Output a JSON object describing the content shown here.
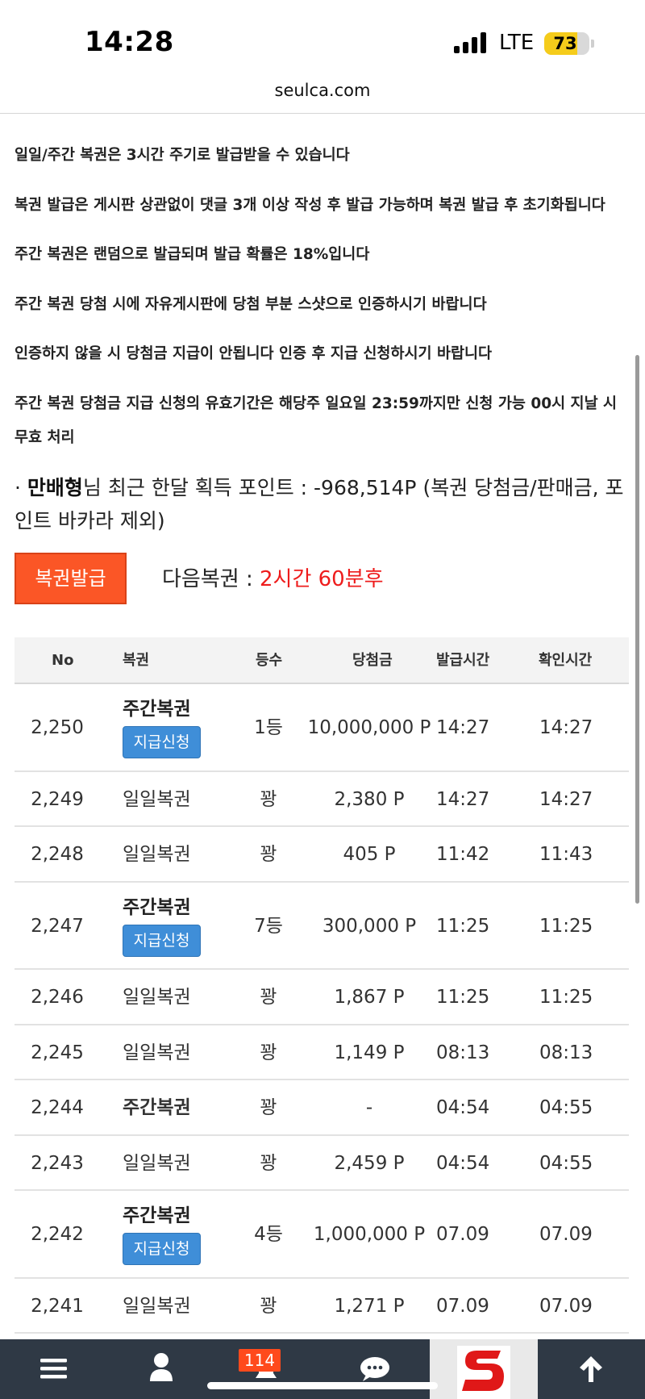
{
  "status_bar": {
    "time": "14:28",
    "network": "LTE",
    "battery": "73"
  },
  "browser": {
    "url": "seulca.com"
  },
  "notices": [
    "일일/주간 복권은 3시간 주기로 발급받을 수 있습니다",
    "복권 발급은 게시판 상관없이 댓글 3개 이상 작성 후 발급 가능하며 복권 발급 후 초기화됩니다",
    "주간 복권은 랜덤으로 발급되며 발급 확률은 18%입니다",
    "주간 복권 당첨 시에 자유게시판에 당첨 부분 스샷으로 인증하시기 바랍니다",
    "인증하지 않을 시 당첨금 지급이 안됩니다 인증 후 지급 신청하시기 바랍니다",
    "주간 복권 당첨금 지급 신청의 유효기간은 해당주 일요일 23:59까지만 신청 가능 00시 지날 시 무효 처리"
  ],
  "points": {
    "bullet": "·",
    "username": "만배형",
    "text": "님 최근 한달 획득 포인트 : -968,514P (복권 당첨금/판매금, 포인트 바카라 제외)"
  },
  "issue": {
    "button_label": "복권발급",
    "next_label": "다음복권 : ",
    "next_value": "2시간 60분후"
  },
  "table": {
    "headers": {
      "no": "No",
      "lottery": "복권",
      "rank": "등수",
      "prize": "당첨금",
      "issued": "발급시간",
      "checked": "확인시간"
    },
    "rows": [
      {
        "no": "2,250",
        "lottery": "주간복권",
        "claim": "지급신청",
        "rank": "1등",
        "prize": "10,000,000 P",
        "issued": "14:27",
        "checked": "14:27"
      },
      {
        "no": "2,249",
        "lottery": "일일복권",
        "rank": "꽝",
        "prize": "2,380 P",
        "issued": "14:27",
        "checked": "14:27"
      },
      {
        "no": "2,248",
        "lottery": "일일복권",
        "rank": "꽝",
        "prize": "405 P",
        "issued": "11:42",
        "checked": "11:43"
      },
      {
        "no": "2,247",
        "lottery": "주간복권",
        "claim": "지급신청",
        "rank": "7등",
        "prize": "300,000 P",
        "issued": "11:25",
        "checked": "11:25"
      },
      {
        "no": "2,246",
        "lottery": "일일복권",
        "rank": "꽝",
        "prize": "1,867 P",
        "issued": "11:25",
        "checked": "11:25"
      },
      {
        "no": "2,245",
        "lottery": "일일복권",
        "rank": "꽝",
        "prize": "1,149 P",
        "issued": "08:13",
        "checked": "08:13"
      },
      {
        "no": "2,244",
        "lottery": "주간복권",
        "rank": "꽝",
        "prize": "-",
        "issued": "04:54",
        "checked": "04:55"
      },
      {
        "no": "2,243",
        "lottery": "일일복권",
        "rank": "꽝",
        "prize": "2,459 P",
        "issued": "04:54",
        "checked": "04:55"
      },
      {
        "no": "2,242",
        "lottery": "주간복권",
        "claim": "지급신청",
        "rank": "4등",
        "prize": "1,000,000 P",
        "issued": "07.09",
        "checked": "07.09"
      },
      {
        "no": "2,241",
        "lottery": "일일복권",
        "rank": "꽝",
        "prize": "1,271 P",
        "issued": "07.09",
        "checked": "07.09"
      }
    ]
  },
  "bottom_nav": {
    "badge": "114",
    "icons": [
      "menu-icon",
      "user-icon",
      "bell-icon",
      "chat-icon",
      "site-logo",
      "arrow-up-icon"
    ]
  },
  "colors": {
    "issue_button": "#fb5626",
    "claim_button": "#3f8ed8",
    "next_time": "#ee1c1c",
    "nav_background": "#2f3945",
    "badge": "#ff4a1c"
  }
}
